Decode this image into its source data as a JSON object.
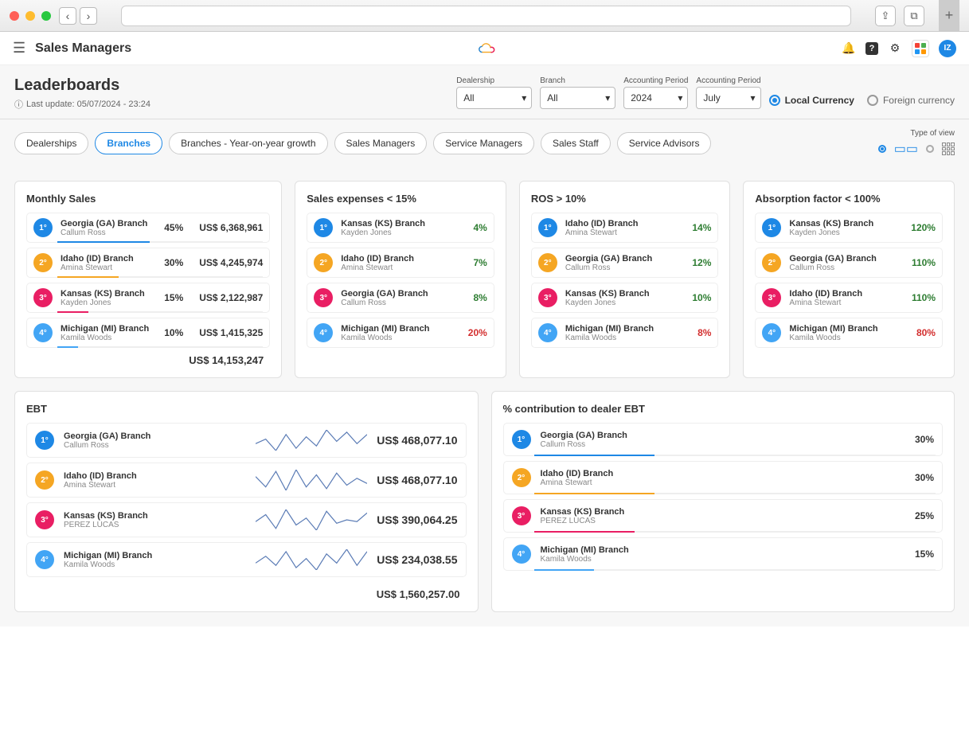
{
  "browser": {
    "close": "",
    "min": "",
    "max": ""
  },
  "header": {
    "title": "Sales Managers",
    "avatar": "IZ"
  },
  "subheader": {
    "page_title": "Leaderboards",
    "last_update_label": "Last update: 05/07/2024 - 23:24",
    "filters": {
      "dealership": {
        "label": "Dealership",
        "value": "All"
      },
      "branch": {
        "label": "Branch",
        "value": "All"
      },
      "period_year": {
        "label": "Accounting Period",
        "value": "2024"
      },
      "period_month": {
        "label": "Accounting Period",
        "value": "July"
      }
    },
    "currency": {
      "local_label": "Local Currency",
      "foreign_label": "Foreign currency"
    }
  },
  "tabs": [
    "Dealerships",
    "Branches",
    "Branches - Year-on-year growth",
    "Sales Managers",
    "Service Managers",
    "Sales Staff",
    "Service Advisors"
  ],
  "view_label": "Type of view",
  "cards": {
    "monthly_sales": {
      "title": "Monthly Sales",
      "items": [
        {
          "rank": "1°",
          "branch": "Georgia (GA) Branch",
          "manager": "Callum Ross",
          "pct": "45%",
          "value": "US$ 6,368,961",
          "fill": 45
        },
        {
          "rank": "2°",
          "branch": "Idaho (ID) Branch",
          "manager": "Amina Stewart",
          "pct": "30%",
          "value": "US$ 4,245,974",
          "fill": 30
        },
        {
          "rank": "3°",
          "branch": "Kansas (KS) Branch",
          "manager": "Kayden Jones",
          "pct": "15%",
          "value": "US$ 2,122,987",
          "fill": 15
        },
        {
          "rank": "4°",
          "branch": "Michigan (MI) Branch",
          "manager": "Kamila Woods",
          "pct": "10%",
          "value": "US$ 1,415,325",
          "fill": 10
        }
      ],
      "total": "US$ 14,153,247"
    },
    "sales_expenses": {
      "title": "Sales expenses < 15%",
      "items": [
        {
          "rank": "1°",
          "branch": "Kansas (KS) Branch",
          "manager": "Kayden Jones",
          "pct": "4%",
          "cls": "green"
        },
        {
          "rank": "2°",
          "branch": "Idaho (ID) Branch",
          "manager": "Amina Stewart",
          "pct": "7%",
          "cls": "green"
        },
        {
          "rank": "3°",
          "branch": "Georgia (GA) Branch",
          "manager": "Callum Ross",
          "pct": "8%",
          "cls": "green"
        },
        {
          "rank": "4°",
          "branch": "Michigan (MI) Branch",
          "manager": "Kamila Woods",
          "pct": "20%",
          "cls": "red"
        }
      ]
    },
    "ros": {
      "title": "ROS > 10%",
      "items": [
        {
          "rank": "1°",
          "branch": "Idaho (ID) Branch",
          "manager": "Amina Stewart",
          "pct": "14%",
          "cls": "green"
        },
        {
          "rank": "2°",
          "branch": "Georgia (GA) Branch",
          "manager": "Callum Ross",
          "pct": "12%",
          "cls": "green"
        },
        {
          "rank": "3°",
          "branch": "Kansas (KS) Branch",
          "manager": "Kayden Jones",
          "pct": "10%",
          "cls": "green"
        },
        {
          "rank": "4°",
          "branch": "Michigan (MI) Branch",
          "manager": "Kamila Woods",
          "pct": "8%",
          "cls": "red"
        }
      ]
    },
    "absorption": {
      "title": "Absorption factor < 100%",
      "items": [
        {
          "rank": "1°",
          "branch": "Kansas (KS) Branch",
          "manager": "Kayden Jones",
          "pct": "120%",
          "cls": "green"
        },
        {
          "rank": "2°",
          "branch": "Georgia (GA) Branch",
          "manager": "Callum Ross",
          "pct": "110%",
          "cls": "green"
        },
        {
          "rank": "3°",
          "branch": "Idaho (ID) Branch",
          "manager": "Amina Stewart",
          "pct": "110%",
          "cls": "green"
        },
        {
          "rank": "4°",
          "branch": "Michigan (MI) Branch",
          "manager": "Kamila Woods",
          "pct": "80%",
          "cls": "red"
        }
      ]
    },
    "ebt": {
      "title": "EBT",
      "items": [
        {
          "rank": "1°",
          "branch": "Georgia (GA) Branch",
          "manager": "Callum Ross",
          "value": "US$ 468,077.10"
        },
        {
          "rank": "2°",
          "branch": "Idaho (ID) Branch",
          "manager": "Amina Stewart",
          "value": "US$ 468,077.10"
        },
        {
          "rank": "3°",
          "branch": "Kansas (KS) Branch",
          "manager": "PEREZ LUCAS",
          "value": "US$ 390,064.25"
        },
        {
          "rank": "4°",
          "branch": "Michigan (MI) Branch",
          "manager": "Kamila Woods",
          "value": "US$ 234,038.55"
        }
      ],
      "total": "US$ 1,560,257.00"
    },
    "contribution": {
      "title": "% contribution to dealer EBT",
      "items": [
        {
          "rank": "1°",
          "branch": "Georgia (GA) Branch",
          "manager": "Callum Ross",
          "pct": "30%",
          "fill": 30
        },
        {
          "rank": "2°",
          "branch": "Idaho (ID) Branch",
          "manager": "Amina Stewart",
          "pct": "30%",
          "fill": 30
        },
        {
          "rank": "3°",
          "branch": "Kansas (KS) Branch",
          "manager": "PEREZ LUCAS",
          "pct": "25%",
          "fill": 25
        },
        {
          "rank": "4°",
          "branch": "Michigan (MI) Branch",
          "manager": "Kamila Woods",
          "pct": "15%",
          "fill": 15
        }
      ]
    }
  },
  "chart_data": [
    {
      "type": "bar",
      "title": "Monthly Sales",
      "categories": [
        "Georgia (GA) Branch",
        "Idaho (ID) Branch",
        "Kansas (KS) Branch",
        "Michigan (MI) Branch"
      ],
      "values": [
        6368961,
        4245974,
        2122987,
        1415325
      ],
      "percentages": [
        45,
        30,
        15,
        10
      ],
      "total": 14153247,
      "unit": "US$"
    },
    {
      "type": "bar",
      "title": "Sales expenses < 15%",
      "threshold": 15,
      "categories": [
        "Kansas (KS) Branch",
        "Idaho (ID) Branch",
        "Georgia (GA) Branch",
        "Michigan (MI) Branch"
      ],
      "values": [
        4,
        7,
        8,
        20
      ],
      "unit": "%"
    },
    {
      "type": "bar",
      "title": "ROS > 10%",
      "threshold": 10,
      "categories": [
        "Idaho (ID) Branch",
        "Georgia (GA) Branch",
        "Kansas (KS) Branch",
        "Michigan (MI) Branch"
      ],
      "values": [
        14,
        12,
        10,
        8
      ],
      "unit": "%"
    },
    {
      "type": "bar",
      "title": "Absorption factor < 100%",
      "threshold": 100,
      "categories": [
        "Kansas (KS) Branch",
        "Georgia (GA) Branch",
        "Idaho (ID) Branch",
        "Michigan (MI) Branch"
      ],
      "values": [
        120,
        110,
        110,
        80
      ],
      "unit": "%"
    },
    {
      "type": "line",
      "title": "EBT",
      "series": [
        {
          "name": "Georgia (GA) Branch",
          "values": [
            40,
            44,
            34,
            48,
            36,
            46,
            38,
            52,
            42,
            50,
            40,
            48
          ]
        },
        {
          "name": "Idaho (ID) Branch",
          "values": [
            46,
            34,
            52,
            30,
            54,
            34,
            48,
            32,
            50,
            36,
            44,
            38
          ]
        },
        {
          "name": "Kansas (KS) Branch",
          "values": [
            38,
            46,
            30,
            52,
            34,
            42,
            28,
            50,
            36,
            40,
            38,
            48
          ]
        },
        {
          "name": "Michigan (MI) Branch",
          "values": [
            36,
            42,
            34,
            46,
            32,
            40,
            30,
            44,
            36,
            48,
            34,
            46
          ]
        }
      ],
      "ylabel": "",
      "xlabel": "",
      "totals_usd": [
        468077.1,
        468077.1,
        390064.25,
        234038.55
      ],
      "grand_total": 1560257.0
    },
    {
      "type": "bar",
      "title": "% contribution to dealer EBT",
      "categories": [
        "Georgia (GA) Branch",
        "Idaho (ID) Branch",
        "Kansas (KS) Branch",
        "Michigan (MI) Branch"
      ],
      "values": [
        30,
        30,
        25,
        15
      ],
      "unit": "%"
    }
  ]
}
